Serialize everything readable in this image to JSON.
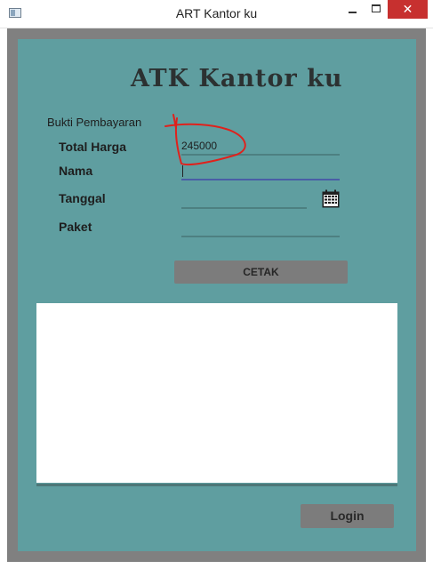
{
  "window": {
    "title": "ART Kantor ku",
    "controls": {
      "minimize": "",
      "maximize": "",
      "close": "✕"
    }
  },
  "app": {
    "title": "ATK Kantor ku",
    "section_label": "Bukti Pembayaran"
  },
  "form": {
    "total_harga": {
      "label": "Total Harga",
      "value": "245000"
    },
    "nama": {
      "label": "Nama",
      "value": ""
    },
    "tanggal": {
      "label": "Tanggal",
      "value": ""
    },
    "paket": {
      "label": "Paket",
      "value": ""
    }
  },
  "buttons": {
    "cetak": "CETAK",
    "login": "Login"
  },
  "output": {
    "text": ""
  },
  "colors": {
    "background": "#5f9ea0",
    "frame": "#808080",
    "button": "#7c7c7c",
    "annotation": "#e0211c"
  },
  "icons": {
    "calendar": "calendar-icon",
    "app": "app-window-icon"
  }
}
